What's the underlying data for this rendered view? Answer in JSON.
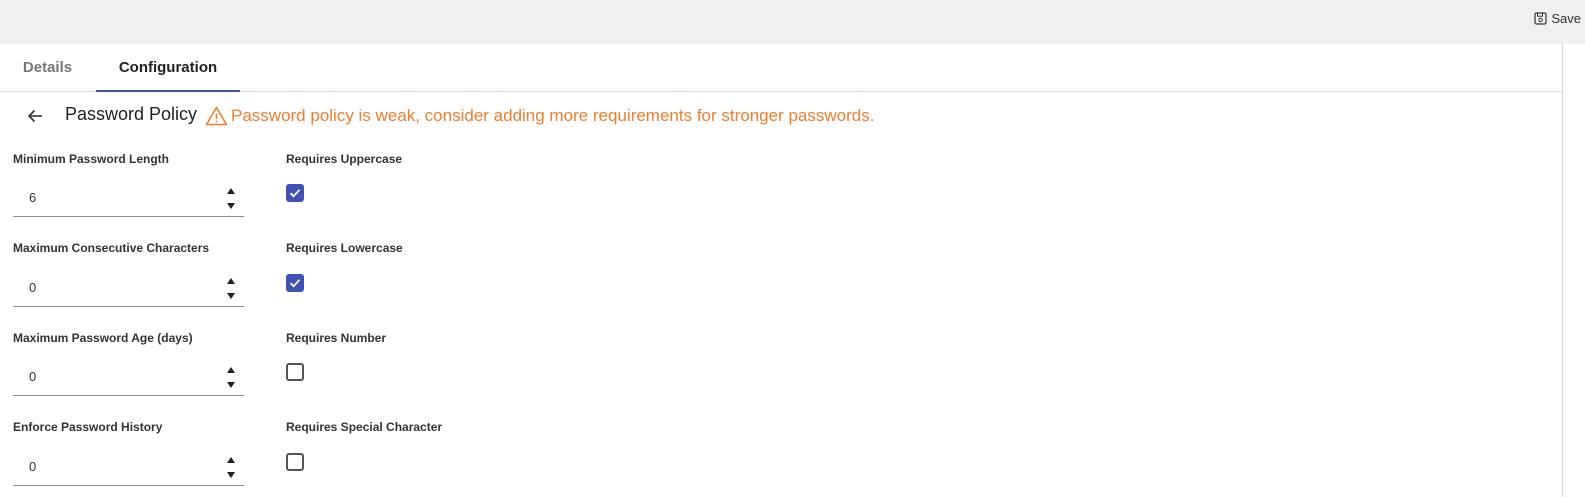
{
  "toolbar": {
    "save_label": "Save"
  },
  "tabs": [
    {
      "label": "Details",
      "active": false
    },
    {
      "label": "Configuration",
      "active": true
    }
  ],
  "header": {
    "title": "Password Policy",
    "warning": "Password policy is weak, consider adding more requirements for stronger passwords."
  },
  "fields": {
    "min_length": {
      "label": "Minimum Password Length",
      "value": "6"
    },
    "max_consecutive": {
      "label": "Maximum Consecutive Characters",
      "value": "0"
    },
    "max_age": {
      "label": "Maximum Password Age (days)",
      "value": "0"
    },
    "history": {
      "label": "Enforce Password History",
      "value": "0"
    }
  },
  "checks": {
    "uppercase": {
      "label": "Requires Uppercase",
      "checked": true
    },
    "lowercase": {
      "label": "Requires Lowercase",
      "checked": true
    },
    "number": {
      "label": "Requires Number",
      "checked": false
    },
    "special": {
      "label": "Requires Special Character",
      "checked": false
    }
  },
  "colors": {
    "accent": "#3f51b5",
    "warning": "#f07d2c",
    "topbar": "#f0f0f0"
  }
}
